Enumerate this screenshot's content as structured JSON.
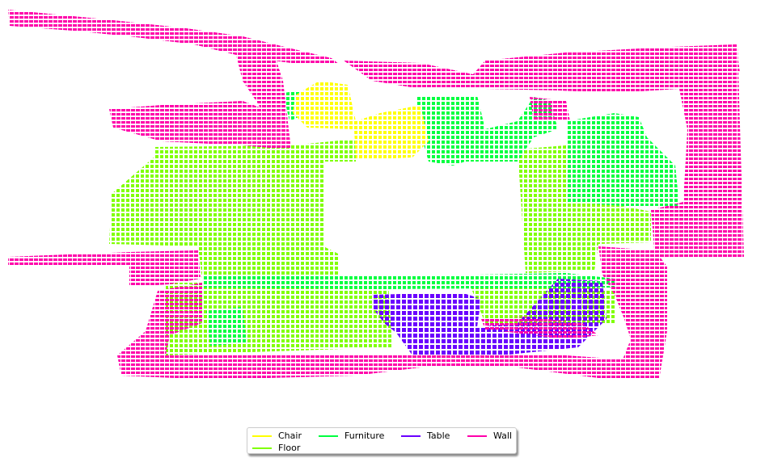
{
  "legend": {
    "items": [
      {
        "key": "chair",
        "label": "Chair",
        "color": "#ffff00"
      },
      {
        "key": "floor",
        "label": "Floor",
        "color": "#80ff00"
      },
      {
        "key": "furniture",
        "label": "Furniture",
        "color": "#00ff40"
      },
      {
        "key": "table",
        "label": "Table",
        "color": "#6a00ff"
      },
      {
        "key": "wall",
        "label": "Wall",
        "color": "#ff00aa"
      }
    ]
  }
}
